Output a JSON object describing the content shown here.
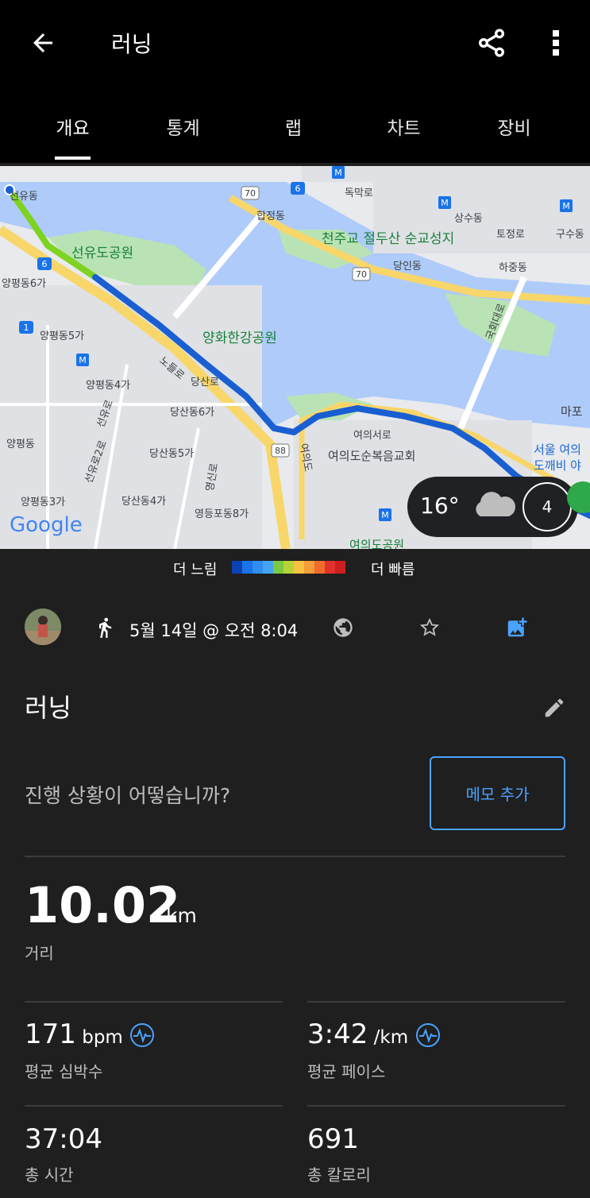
{
  "header": {
    "title": "러닝",
    "back_icon": "arrow-left-icon",
    "share_icon": "share-icon",
    "more_icon": "more-vert-icon"
  },
  "tabs": [
    {
      "label": "개요",
      "active": true
    },
    {
      "label": "통계",
      "active": false
    },
    {
      "label": "랩",
      "active": false
    },
    {
      "label": "차트",
      "active": false
    },
    {
      "label": "장비",
      "active": false
    }
  ],
  "map": {
    "place_labels": [
      "선유도공원",
      "천주교 절두산 순교성지",
      "양화한강공원",
      "양평동6가",
      "양평동5가",
      "양평동4가",
      "양평동3가",
      "당산동6가",
      "당산동5가",
      "당산동4가",
      "영등포동8가",
      "합정동",
      "상수동",
      "당인동",
      "하중동",
      "토정로",
      "구수동",
      "독막로",
      "여의서로",
      "여의도순복음교회",
      "여의도공원",
      "마포",
      "서울 여의",
      "도깨비 야",
      "양평동",
      "노들로",
      "당산로",
      "선유로",
      "선유로2로",
      "선유동",
      "영신로",
      "여의도",
      "국회대로"
    ],
    "road_numbers": [
      "70",
      "6",
      "88",
      "1"
    ],
    "google_logo": "Google",
    "weather": {
      "temp": "16°",
      "icon": "cloud-icon",
      "wind": "4"
    },
    "colors": {
      "water": "#aecbfa",
      "park": "#b9e3b4",
      "land": "#e8eaed",
      "road": "#f8d66a",
      "route_blue": "#1a5fd1",
      "route_green": "#7ed321"
    }
  },
  "legend": {
    "slow": "더 느림",
    "fast": "더 빠름",
    "colors": [
      "#0b43b5",
      "#1a73e8",
      "#2f8ef0",
      "#45a4f2",
      "#7ac943",
      "#b6d334",
      "#f7c242",
      "#f59b38",
      "#f06a2b",
      "#e0322a",
      "#cc1f1f"
    ]
  },
  "meta": {
    "date": "5월 14일 @ 오전 8:04",
    "run_icon": "running-person-icon",
    "privacy_icon": "globe-icon",
    "favorite_icon": "star-outline-icon",
    "photo_icon": "add-photo-icon"
  },
  "activity": {
    "name": "러닝",
    "edit_icon": "pencil-icon",
    "prompt": "진행 상황이 어떻습니까?",
    "memo_button": "메모 추가"
  },
  "summary": {
    "distance": {
      "value": "10.02",
      "unit": "km",
      "label": "거리"
    },
    "avg_hr": {
      "value": "171",
      "unit": " bpm",
      "label": "평균 심박수"
    },
    "avg_pace": {
      "value": "3:42",
      "unit": " /km",
      "label": "평균 페이스"
    },
    "total_time": {
      "value": "37:04",
      "label": "총 시간"
    },
    "calories": {
      "value": "691",
      "label": "총 칼로리"
    }
  }
}
